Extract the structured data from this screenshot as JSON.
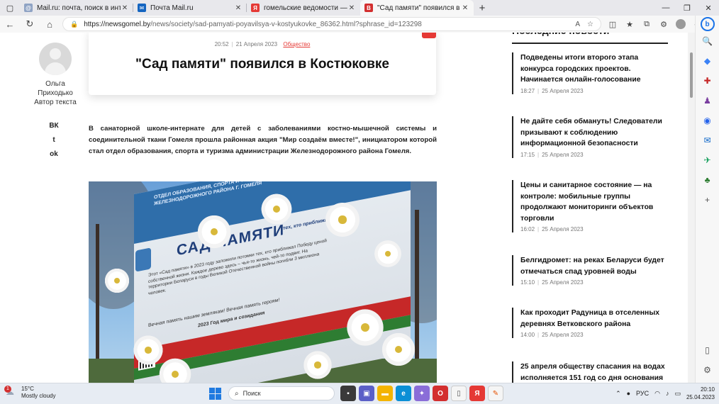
{
  "browser": {
    "tabs": [
      {
        "title": "Mail.ru: почта, поиск в интерне",
        "favicon_color": "#8fa3c4"
      },
      {
        "title": "Почта Mail.ru",
        "favicon_color": "#1565c0"
      },
      {
        "title": "гомельские ведомости — Яндекс",
        "favicon_color": "#e53935"
      },
      {
        "title": "\"Сад памяти\" появился в Костю",
        "favicon_color": "#d32f2f",
        "active": true
      }
    ],
    "favicon_glyphs": {
      "mailru": "@",
      "mail": "✉",
      "yandex": "Я",
      "newsgomel": "В"
    },
    "url_host": "https://newsgomel.by",
    "url_path": "/news/society/sad-pamyati-poyavilsya-v-kostyukovke_86362.html?sphrase_id=123298"
  },
  "author": {
    "first_name": "Ольга",
    "last_name": "Приходько",
    "role": "Автор текста"
  },
  "share": {
    "vk": "ВК",
    "twitter": "t",
    "ok": "ok"
  },
  "article": {
    "time": "20:52",
    "date": "21 Апреля 2023",
    "category": "Общество",
    "title": "\"Сад памяти\" появился в Костюковке",
    "lead": "В  санаторной школе-интернате для детей с заболеваниями костно-мышечной системы и соединительной ткани Гомеля прошла районная акция \"Мир создаём вместе!\", инициатором которой стал отдел образования, спорта и туризма администрации Железнодорожного района Гомеля."
  },
  "photo": {
    "band_text": "ОТДЕЛ ОБРАЗОВАНИЯ, СПОРТА И ТУРИЗМА АДМИНИСТРАЦИИ ЖЕЛЕЗНОДОРОЖНОГО РАЙОНА Г. ГОМЕЛЯ",
    "title": "САД ПАМЯТИ",
    "subtitle": "тех, кто приближал Победу",
    "body": "Этот «Сад памяти» в 2023 году заложили потомки тех, кто приближал Победу ценой собственной жизни. Каждое дерево здесь – чья-то жизнь, чей-то подвиг. На территории Беларуси в годы Великой Отечественной войны погибли 3 миллиона человек.",
    "footer1": "Вечная память нашим землякам! Вечная память героям!",
    "footer2": "2023  Год мира и созидания"
  },
  "news": {
    "heading": "Последние новости",
    "items": [
      {
        "title": "Подведены итоги второго этапа конкурса городских проектов. Начинается онлайн-голосование",
        "time": "18:27",
        "date": "25 Апреля 2023"
      },
      {
        "title": "Не дайте себя обмануть! Следователи призывают к соблюдению информационной безопасности",
        "time": "17:15",
        "date": "25 Апреля 2023"
      },
      {
        "title": "Цены и санитарное состояние — на контроле: мобильные группы продолжают мониторинги объектов торговли",
        "time": "16:02",
        "date": "25 Апреля 2023"
      },
      {
        "title": "Белгидромет: на реках Беларуси будет отмечаться спад уровней воды",
        "time": "15:10",
        "date": "25 Апреля 2023"
      },
      {
        "title": "Как проходит Радуница в отселенных деревнях Ветковского района",
        "time": "14:00",
        "date": "25 Апреля 2023"
      },
      {
        "title": "25 апреля обществу спасания на водах исполняется 151 год со дня основания",
        "time": "",
        "date": ""
      }
    ]
  },
  "taskbar": {
    "weather_badge": "1",
    "temperature": "15°C",
    "condition": "Mostly cloudy",
    "search_placeholder": "Поиск",
    "language": "РУС",
    "time": "20:10",
    "date": "25.04.2023"
  }
}
